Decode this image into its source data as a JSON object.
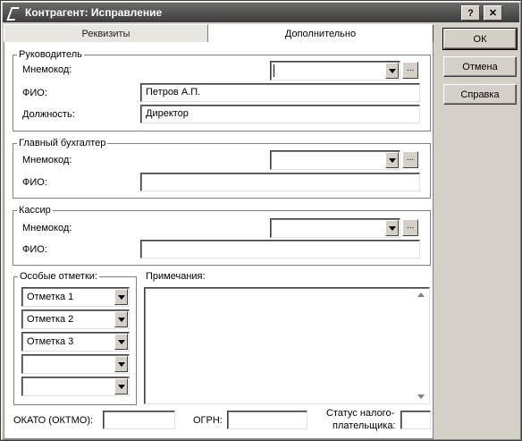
{
  "window": {
    "title": "Контрагент: Исправление",
    "help_btn": "?",
    "close_btn": "✕"
  },
  "tabs": [
    "Реквизиты",
    "Дополнительно"
  ],
  "manager": {
    "legend": "Руководитель",
    "mnemo_label": "Мнемокод:",
    "mnemo_value": "",
    "fio_label": "ФИО:",
    "fio_value": "Петров А.П.",
    "position_label": "Должность:",
    "position_value": "Директор"
  },
  "accountant": {
    "legend": "Главный бухгалтер",
    "mnemo_label": "Мнемокод:",
    "mnemo_value": "",
    "fio_label": "ФИО:",
    "fio_value": ""
  },
  "cashier": {
    "legend": "Кассир",
    "mnemo_label": "Мнемокод:",
    "mnemo_value": "",
    "fio_label": "ФИО:",
    "fio_value": ""
  },
  "marks": {
    "legend": "Особые отметки:",
    "items": [
      "Отметка 1",
      "Отметка 2",
      "Отметка 3",
      "",
      ""
    ]
  },
  "notes": {
    "label": "Примечания:",
    "value": ""
  },
  "bottom": {
    "okato_label": "ОКАТО (ОКТМО):",
    "okato_value": "",
    "ogrn_label": "ОГРН:",
    "ogrn_value": "",
    "status_label1": "Статус налого-",
    "status_label2": "плательщика:",
    "status_value": ""
  },
  "buttons": {
    "ok": "ОК",
    "cancel": "Отмена",
    "help": "Справка"
  },
  "dots_label": "..."
}
